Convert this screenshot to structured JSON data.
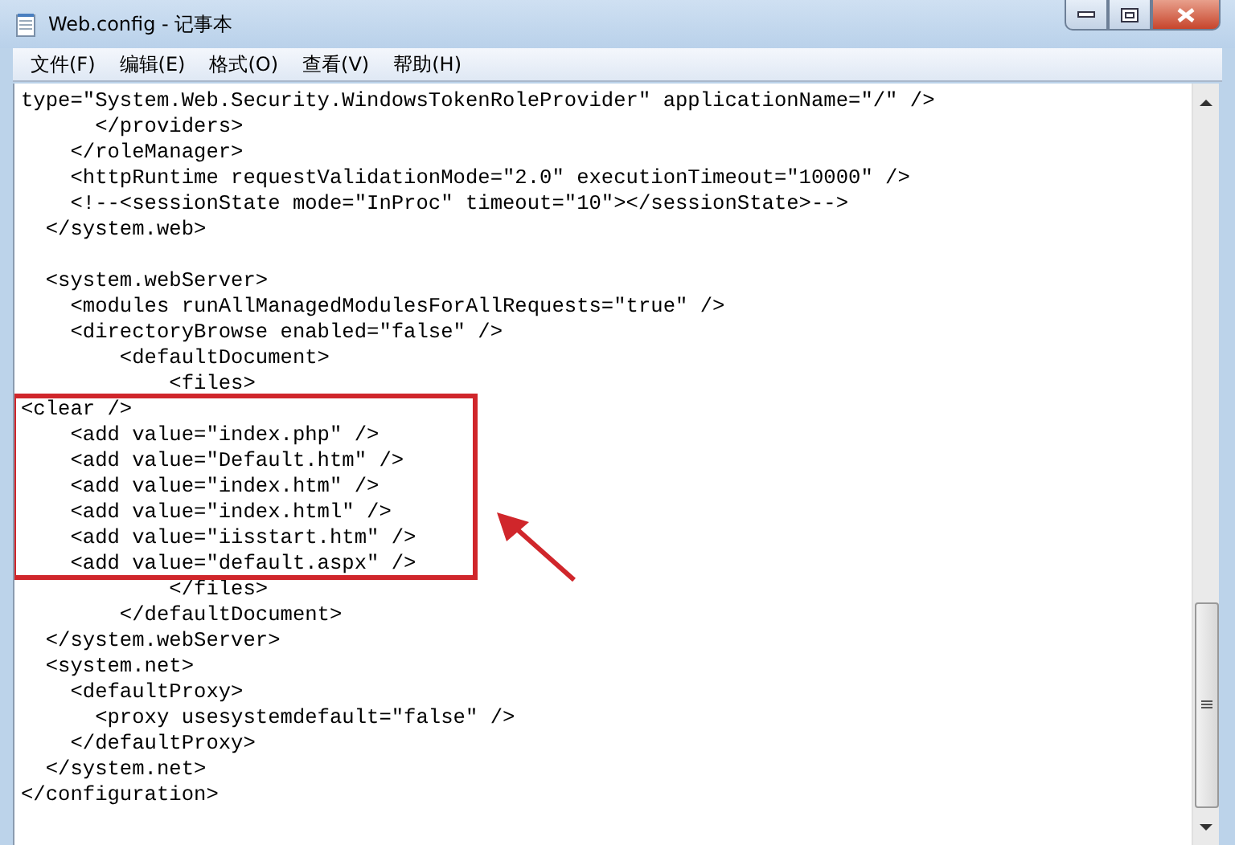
{
  "window": {
    "title": "Web.config - 记事本"
  },
  "menu": [
    "文件(F)",
    "编辑(E)",
    "格式(O)",
    "查看(V)",
    "帮助(H)"
  ],
  "editor": {
    "blocks": [
      {
        "highlighted": false,
        "lines": [
          {
            "kind": "code",
            "text": "type=\"System.Web.Security.WindowsTokenRoleProvider\" applicationName=\"/\" />"
          },
          {
            "kind": "code",
            "text": "      </providers>"
          },
          {
            "kind": "code",
            "text": "    </roleManager>"
          },
          {
            "kind": "code",
            "text": "    <httpRuntime requestValidationMode=\"2.0\" executionTimeout=\"10000\" />"
          },
          {
            "kind": "code",
            "text": "    <!--<sessionState mode=\"InProc\" timeout=\"10\"></sessionState>-->"
          },
          {
            "kind": "code",
            "text": "  </system.web>"
          },
          {
            "kind": "blank"
          },
          {
            "kind": "code",
            "text": "  <system.webServer>"
          },
          {
            "kind": "code",
            "text": "    <modules runAllManagedModulesForAllRequests=\"true\" />"
          },
          {
            "kind": "code",
            "text": "    <directoryBrowse enabled=\"false\" />"
          },
          {
            "kind": "code",
            "text": "        <defaultDocument>"
          },
          {
            "kind": "code",
            "text": "            <files>"
          }
        ]
      },
      {
        "highlighted": true,
        "lines": [
          {
            "kind": "code",
            "text": "<clear />"
          },
          {
            "kind": "code",
            "text": "    <add value=\"index.php\" />"
          },
          {
            "kind": "code",
            "text": "    <add value=\"Default.htm\" />"
          },
          {
            "kind": "code",
            "text": "    <add value=\"index.htm\" />"
          },
          {
            "kind": "code",
            "text": "    <add value=\"index.html\" />"
          },
          {
            "kind": "code",
            "text": "    <add value=\"iisstart.htm\" />"
          },
          {
            "kind": "code",
            "text": "    <add value=\"default.aspx\" />"
          }
        ]
      },
      {
        "highlighted": false,
        "lines": [
          {
            "kind": "code",
            "text": "            </files>"
          },
          {
            "kind": "code",
            "text": "        </defaultDocument>"
          },
          {
            "kind": "code",
            "text": "  </system.webServer>"
          },
          {
            "kind": "code",
            "text": "  <system.net>"
          },
          {
            "kind": "code",
            "text": "    <defaultProxy>"
          },
          {
            "kind": "code",
            "text": "      <proxy usesystemdefault=\"false\" />"
          },
          {
            "kind": "code",
            "text": "    </defaultProxy>"
          },
          {
            "kind": "code",
            "text": "  </system.net>"
          },
          {
            "kind": "code",
            "text": "</configuration>"
          }
        ]
      }
    ]
  }
}
